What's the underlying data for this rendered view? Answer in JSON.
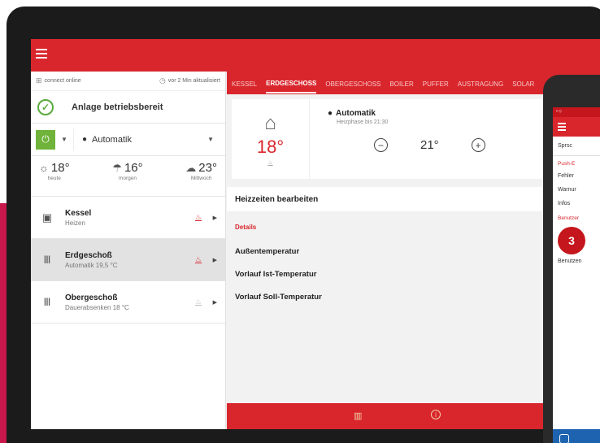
{
  "status": {
    "connection": "connect online",
    "updated": "vor 2 Min aktualisiert"
  },
  "system": {
    "ready": "Anlage betriebsbereit"
  },
  "mode": {
    "label": "Automatik"
  },
  "weather": [
    {
      "temp": "18°",
      "label": "heute",
      "icon": "sun-icon"
    },
    {
      "temp": "16°",
      "label": "morgen",
      "icon": "rain-icon"
    },
    {
      "temp": "23°",
      "label": "Mittwoch",
      "icon": "cloud-icon"
    }
  ],
  "zones": [
    {
      "name": "Kessel",
      "sub": "Heizen",
      "icon": "boiler-icon",
      "heating": true
    },
    {
      "name": "Erdgeschoß",
      "sub": "Automatik 19,5 °C",
      "icon": "radiator-1-icon",
      "heating": true
    },
    {
      "name": "Obergeschoß",
      "sub": "Dauerabsenken 18 °C",
      "icon": "radiator-2-icon",
      "heating": false
    }
  ],
  "tabs": [
    "KESSEL",
    "ERDGESCHOSS",
    "OBERGESCHOSS",
    "BOILER",
    "PUFFER",
    "AUSTRAGUNG",
    "SOLAR"
  ],
  "active_tab": "ERDGESCHOSS",
  "detail": {
    "current_temp": "18°",
    "mode_title": "Automatik",
    "mode_sub": "Heizphase bis 21:30",
    "set_temp": "21°",
    "edit_label": "Heizzeiten bearbeiten",
    "details_header": "Details",
    "rows": [
      "Außentemperatur",
      "Vorlauf Ist-Temperatur",
      "Vorlauf Soll-Temperatur"
    ]
  },
  "phone": {
    "line1": "Sprsc",
    "section1": "Push-E",
    "items": [
      "Fehler",
      "Warnur",
      "Infos"
    ],
    "section2": "Benutzer",
    "footer_link": "Benutzen"
  },
  "colors": {
    "brand_red": "#d9262c",
    "ok_green": "#5aaa3c",
    "power_green": "#6fb33a"
  }
}
